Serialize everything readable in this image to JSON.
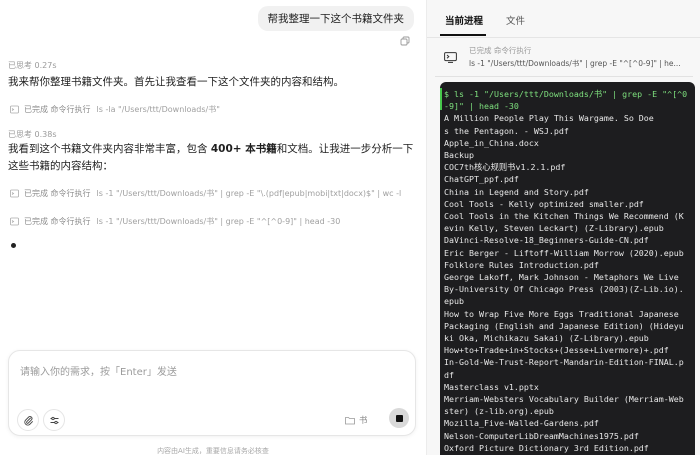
{
  "chat": {
    "user_message": "帮我整理一下这个书籍文件夹",
    "think1": "已思考 0.27s",
    "para1": "我来帮你整理书籍文件夹。首先让我查看一下这个文件夹的内容和结构。",
    "tool1": {
      "status": "已完成 命令行执行",
      "cmd": "ls -la \"/Users/ttt/Downloads/书\""
    },
    "think2": "已思考 0.38s",
    "para2_a": "我看到这个书籍文件夹内容非常丰富，包含 ",
    "para2_bold": "400+ 本书籍",
    "para2_b": "和文档。让我进一步分析一下这些书籍的内容结构：",
    "tool2": {
      "status": "已完成 命令行执行",
      "cmd": "ls -1 \"/Users/ttt/Downloads/书\" | grep -E \"\\.(pdf|epub|mobi|txt|docx)$\" | wc -l"
    },
    "tool3": {
      "status": "已完成 命令行执行",
      "cmd": "ls -1 \"/Users/ttt/Downloads/书\" | grep -E \"^[^0-9]\" | head -30"
    }
  },
  "input": {
    "placeholder": "请输入你的需求，按「Enter」发送",
    "folder_label": "书"
  },
  "disclaimer": "内容由AI生成，重要信息请务必核查",
  "panel": {
    "tabs": [
      "当前进程",
      "文件"
    ],
    "process": {
      "status": "已完成 命令行执行",
      "cmd": "ls -1 \"/Users/ttt/Downloads/书\" | grep -E \"^[^0-9]\" | he..."
    },
    "terminal_lines": [
      "$ ls -1 \"/Users/ttt/Downloads/书\" | grep -E \"^[^0",
      "-9]\" | head -30",
      "A Million People Play This Wargame. So Doe",
      "s the Pentagon. - WSJ.pdf",
      "Apple_in_China.docx",
      "Backup",
      "COC7th核心规则书v1.2.1.pdf",
      "ChatGPT_ppf.pdf",
      "China in Legend and Story.pdf",
      "Cool Tools - Kelly optimized smaller.pdf",
      "Cool Tools in the Kitchen Things We Recommend (K",
      "evin Kelly, Steven Leckart) (Z-Library).epub",
      "DaVinci-Resolve-18_Beginners-Guide-CN.pdf",
      "Eric Berger - Liftoff-William Morrow (2020).epub",
      "Folklore Rules Introduction.pdf",
      "George Lakoff, Mark Johnson - Metaphors We Live",
      "By-University Of Chicago Press (2003)(Z-Lib.io).",
      "epub",
      "How to Wrap Five More Eggs Traditional Japanese",
      "Packaging (English and Japanese Edition) (Hideyu",
      "ki Oka, Michikazu Sakai) (Z-Library).epub",
      "How+to+Trade+in+Stocks+(Jesse+Livermore)+.pdf",
      "In-Gold-We-Trust-Report-Mandarin-Edition-FINAL.p",
      "df",
      "Masterclass v1.pptx",
      "Merriam-Websters Vocabulary Builder (Merriam-Web",
      "ster) (z-lib.org).epub",
      "Mozilla_Five-Walled-Gardens.pdf",
      "Nelson-ComputerLibDreamMachines1975.pdf",
      "Oxford Picture Dictionary 3rd Edition.pdf"
    ]
  }
}
